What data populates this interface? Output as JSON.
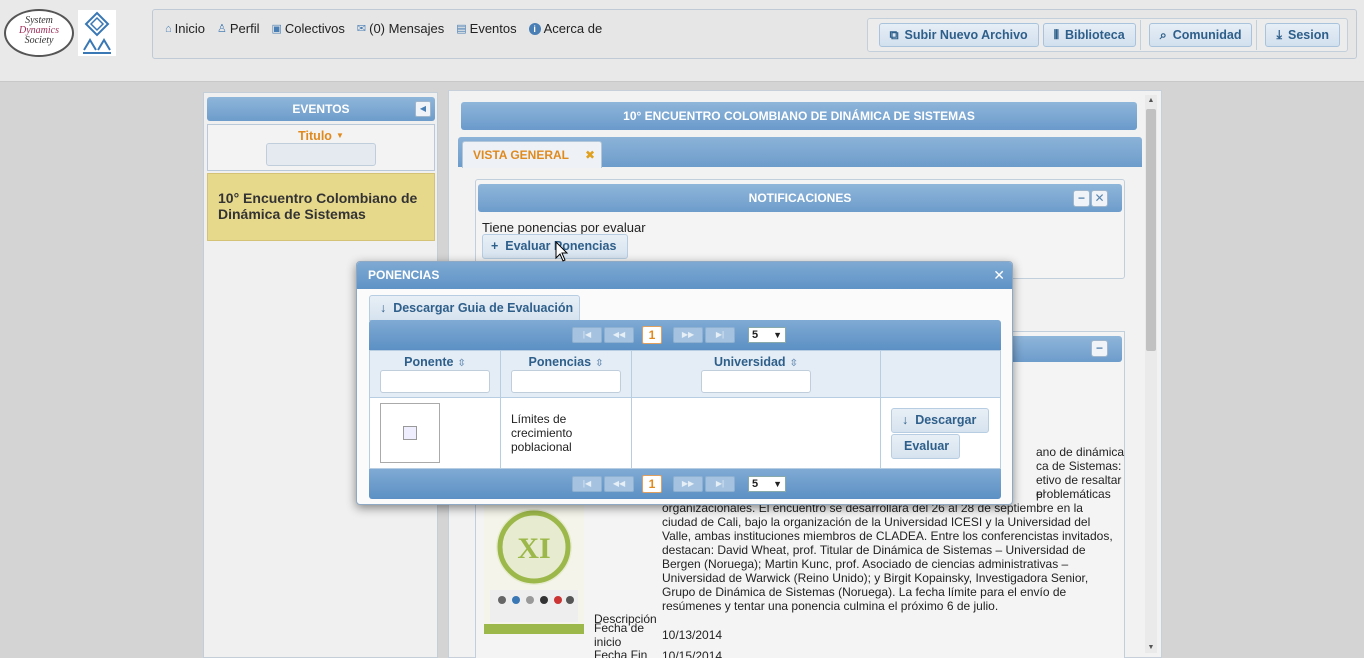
{
  "header": {
    "logo_lines": [
      "System",
      "Dynamics",
      "Society"
    ],
    "nav": [
      {
        "icon": "home-icon",
        "label": "Inicio"
      },
      {
        "icon": "user-icon",
        "label": "Perfil"
      },
      {
        "icon": "group-icon",
        "label": "Colectivos"
      },
      {
        "icon": "mail-icon",
        "label": "(0) Mensajes"
      },
      {
        "icon": "calendar-icon",
        "label": "Eventos"
      },
      {
        "icon": "info-icon",
        "label": "Acerca de"
      }
    ],
    "actions": {
      "upload": "Subir Nuevo Archivo",
      "library": "Biblioteca",
      "community": "Comunidad",
      "session": "Sesion"
    }
  },
  "sidebar": {
    "title": "EVENTOS",
    "filter_label": "Titulo",
    "filter_value": "",
    "items": [
      "10° Encuentro Colombiano de Dinámica de Sistemas"
    ]
  },
  "main": {
    "title": "10° ENCUENTRO COLOMBIANO DE DINÁMICA DE SISTEMAS",
    "tab": "VISTA GENERAL",
    "notifications": {
      "title": "NOTIFICACIONES",
      "text": "Tiene ponencias por evaluar",
      "button": "Evaluar Ponencias"
    },
    "detail": {
      "desc_partial_lines": [
        "ano de dinámica",
        "ca de Sistemas:",
        "etivo de resaltar el",
        "problemáticas",
        "organizacionales. El encuentro se desarrollará del 26 al 28 de septiembre en la"
      ],
      "labels": {
        "description": "Descripción",
        "start": "Fecha de inicio",
        "end": "Fecha Fin"
      },
      "description_lines": [
        "ciudad de Cali, bajo la organización de la Universidad ICESI y la Universidad del",
        "Valle, ambas instituciones miembros de CLADEA. Entre los conferencistas invitados,",
        "destacan: David Wheat, prof. Titular de Dinámica de Sistemas – Universidad de",
        "Bergen (Noruega); Martin Kunc, prof. Asociado de ciencias administrativas –",
        "Universidad de Warwick (Reino Unido); y Birgit Kopainsky, Investigadora Senior,",
        "Grupo de Dinámica de Sistemas (Noruega). La fecha límite para el envío de",
        "resúmenes y tentar una ponencia culmina el próximo 6 de julio."
      ],
      "start_date": "10/13/2014",
      "end_date": "10/15/2014"
    }
  },
  "dialog": {
    "title": "PONENCIAS",
    "download_guide": "Descargar Guia de Evaluación",
    "paginator": {
      "current_page": "1",
      "rows_per_page": "5"
    },
    "columns": [
      "Ponente",
      "Ponencias",
      "Universidad"
    ],
    "rows": [
      {
        "ponencia": "Límites de crecimiento poblacional",
        "universidad": ""
      }
    ],
    "row_actions": {
      "download": "Descargar",
      "evaluate": "Evaluar"
    }
  }
}
